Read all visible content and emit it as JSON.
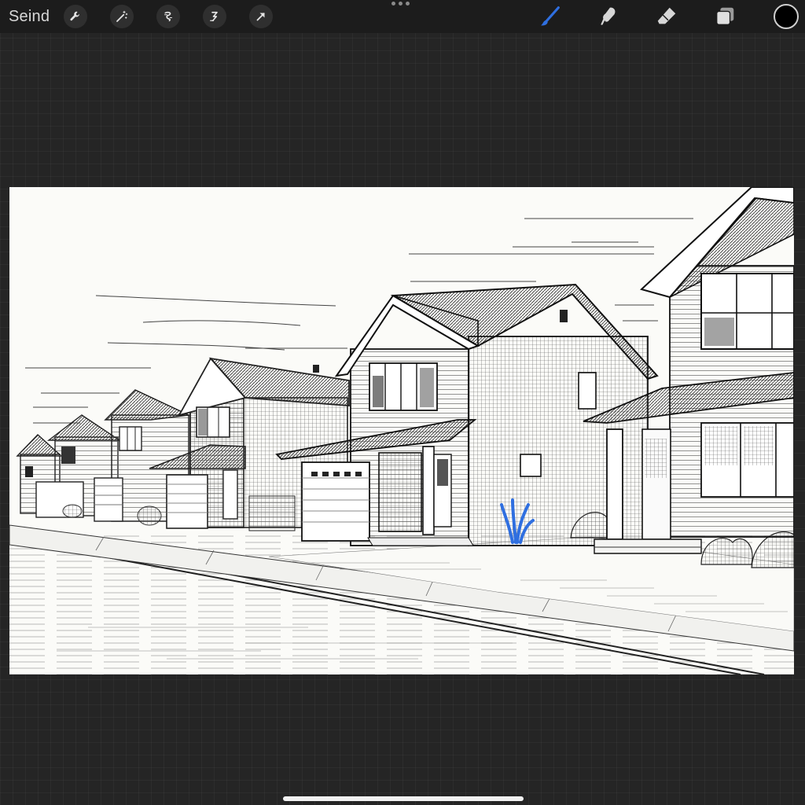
{
  "topbar": {
    "gallery_label": "Seind",
    "left_tools": [
      {
        "icon": "wrench-icon",
        "name": "actions"
      },
      {
        "icon": "magic-wand-icon",
        "name": "adjustments"
      },
      {
        "icon": "selection-icon",
        "name": "selection"
      },
      {
        "icon": "transform-icon",
        "name": "transform"
      },
      {
        "icon": "arrow-icon",
        "name": "move"
      }
    ],
    "right_tools": [
      {
        "icon": "brush-icon",
        "name": "paint",
        "active": true
      },
      {
        "icon": "smudge-icon",
        "name": "smudge",
        "active": false
      },
      {
        "icon": "eraser-icon",
        "name": "eraser",
        "active": false
      },
      {
        "icon": "layers-icon",
        "name": "layers",
        "active": false
      }
    ],
    "current_color": "#000000"
  },
  "colors": {
    "accent": "#2f6fe0",
    "canvas_bg": "#fbfbf8",
    "workspace_bg": "#252525",
    "toolbar_bg": "#1c1c1c"
  },
  "canvas": {
    "content": "ink-drawing-suburban-street"
  }
}
